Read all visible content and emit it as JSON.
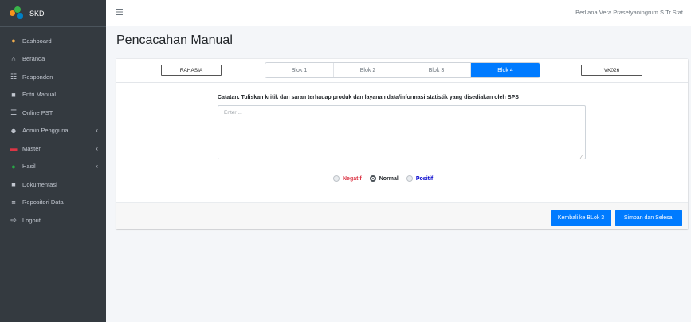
{
  "brand": {
    "name": "SKD"
  },
  "sidebar": {
    "items": [
      {
        "label": "Dashboard",
        "icon": "palette-icon",
        "glyph": "●",
        "color": "#f0ad4e",
        "caret": false
      },
      {
        "label": "Beranda",
        "icon": "home-icon",
        "glyph": "⌂",
        "color": "#c2c7d0",
        "caret": false
      },
      {
        "label": "Responden",
        "icon": "users-icon",
        "glyph": "☷",
        "color": "#c2c7d0",
        "caret": false
      },
      {
        "label": "Entri Manual",
        "icon": "file-icon",
        "glyph": "■",
        "color": "#c2c7d0",
        "caret": false
      },
      {
        "label": "Online PST",
        "icon": "list-icon",
        "glyph": "☰",
        "color": "#c2c7d0",
        "caret": false
      },
      {
        "label": "Admin Pengguna",
        "icon": "user-cog-icon",
        "glyph": "☻",
        "color": "#c2c7d0",
        "caret": true
      },
      {
        "label": "Master",
        "icon": "folder-icon",
        "glyph": "▬",
        "color": "#dc3545",
        "caret": true
      },
      {
        "label": "Hasil",
        "icon": "circle-icon",
        "glyph": "●",
        "color": "#28a745",
        "caret": true
      },
      {
        "label": "Dokumentasi",
        "icon": "document-icon",
        "glyph": "■",
        "color": "#c2c7d0",
        "caret": false
      },
      {
        "label": "Repositori Data",
        "icon": "database-icon",
        "glyph": "≡",
        "color": "#c2c7d0",
        "caret": false
      },
      {
        "label": "Logout",
        "icon": "logout-icon",
        "glyph": "⇨",
        "color": "#c2c7d0",
        "caret": false
      }
    ]
  },
  "topbar": {
    "user": "Berliana Vera Prasetyaningrum S.Tr.Stat."
  },
  "page": {
    "title": "Pencacahan Manual"
  },
  "header": {
    "secret_label": "RAHASIA",
    "code_label": "VK026",
    "tabs": [
      "Blok 1",
      "Blok 2",
      "Blok 3",
      "Blok 4"
    ],
    "active_tab": 3
  },
  "form": {
    "catatan_label": "Catatan. Tuliskan kritik dan saran terhadap produk dan layanan data/informasi statistik yang disediakan oleh BPS",
    "textarea_placeholder": "Enter ...",
    "radios": [
      {
        "label": "Negatif",
        "color": "#dc3545",
        "checked": false
      },
      {
        "label": "Normal",
        "color": "#212529",
        "checked": true
      },
      {
        "label": "Positif",
        "color": "#0000cc",
        "checked": false
      }
    ]
  },
  "footer": {
    "back_label": "Kembali ke BLok 3",
    "save_label": "Simpan dan Selesai"
  },
  "colors": {
    "primary": "#007bff",
    "sidebar_bg": "#343a40"
  }
}
